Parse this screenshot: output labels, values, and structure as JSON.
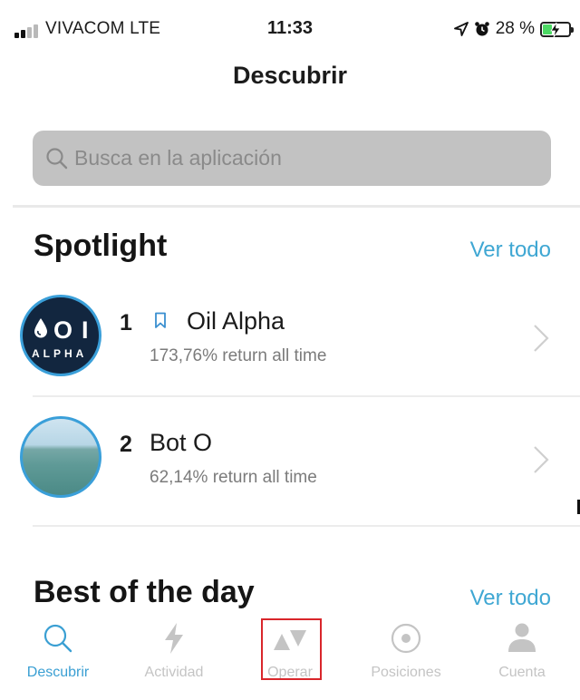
{
  "status_bar": {
    "carrier": "VIVACOM  LTE",
    "time": "11:33",
    "battery_percent": "28 %"
  },
  "header": {
    "title": "Descubrir"
  },
  "search": {
    "placeholder": "Busca en la aplicación"
  },
  "spotlight": {
    "title": "Spotlight",
    "see_all": "Ver todo",
    "items": [
      {
        "rank": "1",
        "name": "Oil Alpha",
        "subtitle": "173,76% return all time",
        "avatar_text_top": "OIL",
        "avatar_text_bottom": "ALPHA"
      },
      {
        "rank": "2",
        "name": "Bot O",
        "subtitle": "62,14% return all time"
      }
    ]
  },
  "best_of_day": {
    "title": "Best of the day",
    "see_all": "Ver todo"
  },
  "tabbar": {
    "tabs": [
      {
        "label": "Descubrir",
        "active": true
      },
      {
        "label": "Actividad",
        "active": false
      },
      {
        "label": "Operar",
        "active": false
      },
      {
        "label": "Posiciones",
        "active": false
      },
      {
        "label": "Cuenta",
        "active": false
      }
    ]
  },
  "colors": {
    "accent": "#3fa7d3",
    "highlight_box": "#d9262b",
    "search_bg": "#c2c2c2"
  }
}
